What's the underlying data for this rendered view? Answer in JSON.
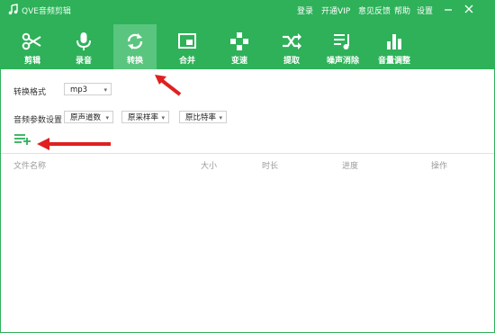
{
  "window": {
    "title": "QVE音频剪辑"
  },
  "menu": [
    "登录",
    "开通VIP",
    "意见反馈",
    "帮助",
    "设置"
  ],
  "toolbar": [
    {
      "label": "剪辑",
      "icon": "scissors-icon",
      "active": false
    },
    {
      "label": "录音",
      "icon": "microphone-icon",
      "active": false
    },
    {
      "label": "转换",
      "icon": "convert-icon",
      "active": true
    },
    {
      "label": "合并",
      "icon": "merge-icon",
      "active": false
    },
    {
      "label": "变速",
      "icon": "speed-icon",
      "active": false
    },
    {
      "label": "提取",
      "icon": "extract-icon",
      "active": false
    },
    {
      "label": "噪声消除",
      "icon": "denoise-icon",
      "active": false
    },
    {
      "label": "音量调整",
      "icon": "volume-adjust-icon",
      "active": false
    }
  ],
  "convert": {
    "format_label": "转换格式",
    "format_value": "mp3",
    "params_label": "音频参数设置",
    "channels_value": "原声道数",
    "samplerate_value": "原采样率",
    "bitrate_value": "原比特率"
  },
  "table": {
    "columns": [
      "文件名称",
      "大小",
      "时长",
      "进度",
      "操作"
    ]
  },
  "colors": {
    "brand": "#2eb159",
    "active_tab": "#5ac57e",
    "arrow": "#e02020"
  }
}
